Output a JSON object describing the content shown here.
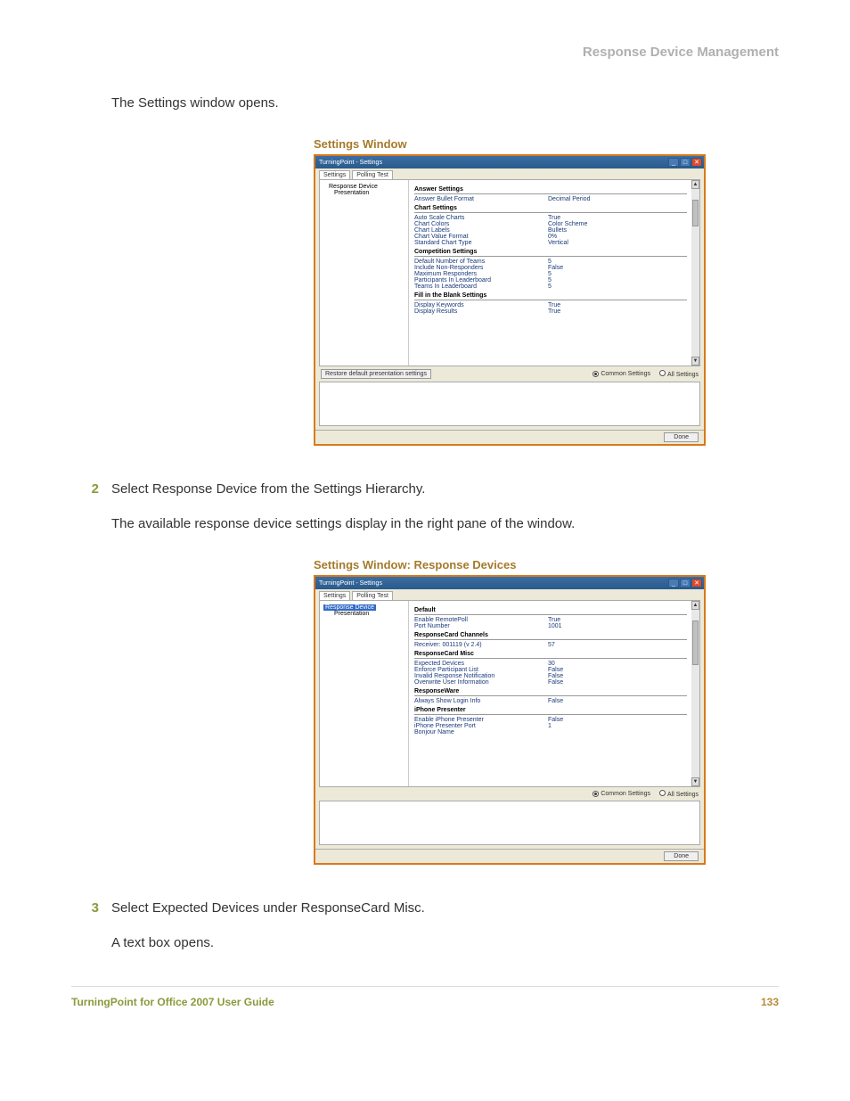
{
  "header": {
    "section": "Response Device Management"
  },
  "intro": "The Settings window opens.",
  "caption1": "Settings Window",
  "window1": {
    "title": "TurningPoint - Settings",
    "tabs": [
      "Settings",
      "Polling Test"
    ],
    "tree": {
      "item1": "Response Device",
      "item2": "Presentation"
    },
    "sections": {
      "answer": {
        "head": "Answer Settings",
        "r1k": "Answer Bullet Format",
        "r1v": "Decimal Period"
      },
      "chart": {
        "head": "Chart Settings",
        "r1k": "Auto Scale Charts",
        "r1v": "True",
        "r2k": "Chart Colors",
        "r2v": "Color Scheme",
        "r3k": "Chart Labels",
        "r3v": "Bullets",
        "r4k": "Chart Value Format",
        "r4v": "0%",
        "r5k": "Standard Chart Type",
        "r5v": "Vertical"
      },
      "comp": {
        "head": "Competition Settings",
        "r1k": "Default Number of Teams",
        "r1v": "5",
        "r2k": "Include Non-Responders",
        "r2v": "False",
        "r3k": "Maximum Responders",
        "r3v": "5",
        "r4k": "Participants In Leaderboard",
        "r4v": "5",
        "r5k": "Teams In Leaderboard",
        "r5v": "5"
      },
      "fill": {
        "head": "Fill in the Blank Settings",
        "r1k": "Display Keywords",
        "r1v": "True",
        "r2k": "Display Results",
        "r2v": "True"
      }
    },
    "restore": "Restore default presentation settings",
    "radios": {
      "common": "Common Settings",
      "all": "All Settings"
    },
    "done": "Done"
  },
  "step2": {
    "num": "2",
    "text": "Select Response Device from the Settings Hierarchy."
  },
  "step2sub": "The available response device settings display in the right pane of the window.",
  "caption2": "Settings Window: Response Devices",
  "window2": {
    "title": "TurningPoint - Settings",
    "tabs": [
      "Settings",
      "Polling Test"
    ],
    "tree": {
      "item1": "Response Device",
      "item2": "Presentation"
    },
    "sections": {
      "default": {
        "head": "Default",
        "r1k": "Enable RemotePoll",
        "r1v": "True",
        "r2k": "Port Number",
        "r2v": "1001"
      },
      "channels": {
        "head": "ResponseCard Channels",
        "r1k": "Receiver: 001119 (v 2.4)",
        "r1v": "57"
      },
      "misc": {
        "head": "ResponseCard Misc",
        "r1k": "Expected Devices",
        "r1v": "30",
        "r2k": "Enforce Participant List",
        "r2v": "False",
        "r3k": "Invalid Response Notification",
        "r3v": "False",
        "r4k": "Overwrite User Information",
        "r4v": "False"
      },
      "rware": {
        "head": "ResponseWare",
        "r1k": "Always Show Login Info",
        "r1v": "False"
      },
      "iphone": {
        "head": "iPhone Presenter",
        "r1k": "Enable iPhone Presenter",
        "r1v": "False",
        "r2k": "iPhone Presenter Port",
        "r2v": "1",
        "r3k": "Bonjour Name",
        "r3v": ""
      }
    },
    "radios": {
      "common": "Common Settings",
      "all": "All Settings"
    },
    "done": "Done"
  },
  "step3": {
    "num": "3",
    "text": "Select Expected Devices under ResponseCard Misc."
  },
  "step3sub": "A text box opens.",
  "footer": {
    "left": "TurningPoint for Office 2007 User Guide",
    "right": "133"
  }
}
